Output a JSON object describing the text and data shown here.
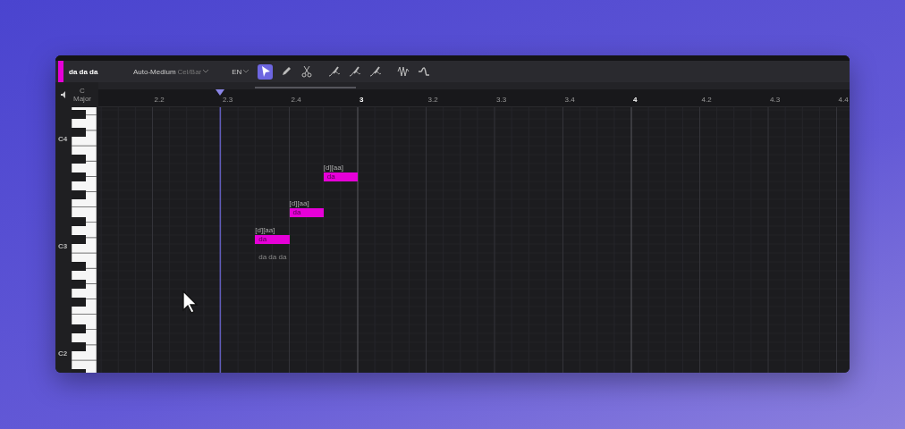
{
  "track": {
    "name": "da da da",
    "color": "#e600d8"
  },
  "voice": {
    "mode": "Auto-Medium",
    "unit": "Cel/Bar"
  },
  "language": "EN",
  "tools": [
    {
      "kind": "select",
      "selected": true
    },
    {
      "kind": "pencil",
      "selected": false
    },
    {
      "kind": "scissors",
      "selected": false
    },
    {
      "kind": "pitch",
      "selected": false
    },
    {
      "kind": "vibrato",
      "selected": false
    },
    {
      "kind": "volume",
      "selected": false
    },
    {
      "kind": "wave",
      "selected": false
    },
    {
      "kind": "smooth",
      "selected": false
    }
  ],
  "key": {
    "tonic": "C",
    "mode": "Major"
  },
  "octave_labels": [
    "C4",
    "C3",
    "C2"
  ],
  "ruler": [
    "2.2",
    "2.3",
    "2.4",
    "3",
    "3.2",
    "3.3",
    "3.4",
    "4",
    "4.2",
    "4.3",
    "4.4"
  ],
  "notes": [
    {
      "lyric": "da",
      "phonemes": "[d][aa]"
    },
    {
      "lyric": "da",
      "phonemes": "[d][aa]"
    },
    {
      "lyric": "da",
      "phonemes": "[d][aa]"
    }
  ],
  "lyrics_preview": "da da da"
}
